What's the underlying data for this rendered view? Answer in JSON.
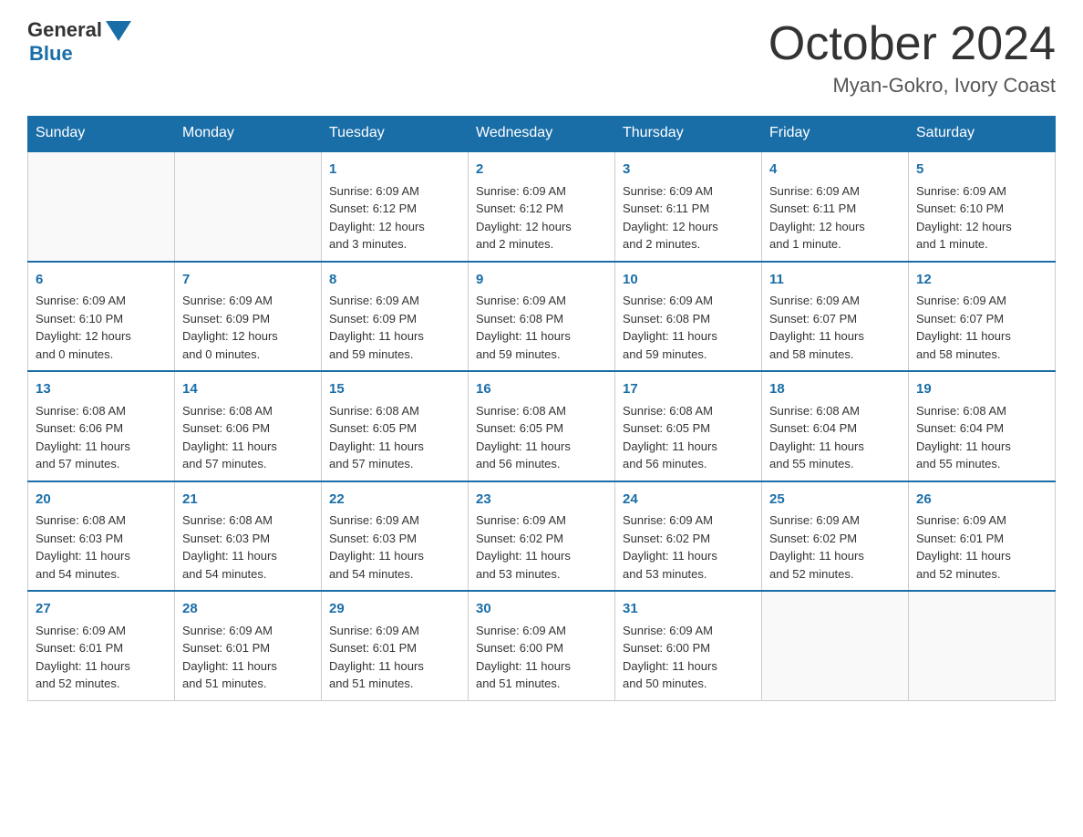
{
  "header": {
    "logo_general": "General",
    "logo_blue": "Blue",
    "month_title": "October 2024",
    "location": "Myan-Gokro, Ivory Coast"
  },
  "days_of_week": [
    "Sunday",
    "Monday",
    "Tuesday",
    "Wednesday",
    "Thursday",
    "Friday",
    "Saturday"
  ],
  "weeks": [
    [
      {
        "day": "",
        "content": ""
      },
      {
        "day": "",
        "content": ""
      },
      {
        "day": "1",
        "content": "Sunrise: 6:09 AM\nSunset: 6:12 PM\nDaylight: 12 hours\nand 3 minutes."
      },
      {
        "day": "2",
        "content": "Sunrise: 6:09 AM\nSunset: 6:12 PM\nDaylight: 12 hours\nand 2 minutes."
      },
      {
        "day": "3",
        "content": "Sunrise: 6:09 AM\nSunset: 6:11 PM\nDaylight: 12 hours\nand 2 minutes."
      },
      {
        "day": "4",
        "content": "Sunrise: 6:09 AM\nSunset: 6:11 PM\nDaylight: 12 hours\nand 1 minute."
      },
      {
        "day": "5",
        "content": "Sunrise: 6:09 AM\nSunset: 6:10 PM\nDaylight: 12 hours\nand 1 minute."
      }
    ],
    [
      {
        "day": "6",
        "content": "Sunrise: 6:09 AM\nSunset: 6:10 PM\nDaylight: 12 hours\nand 0 minutes."
      },
      {
        "day": "7",
        "content": "Sunrise: 6:09 AM\nSunset: 6:09 PM\nDaylight: 12 hours\nand 0 minutes."
      },
      {
        "day": "8",
        "content": "Sunrise: 6:09 AM\nSunset: 6:09 PM\nDaylight: 11 hours\nand 59 minutes."
      },
      {
        "day": "9",
        "content": "Sunrise: 6:09 AM\nSunset: 6:08 PM\nDaylight: 11 hours\nand 59 minutes."
      },
      {
        "day": "10",
        "content": "Sunrise: 6:09 AM\nSunset: 6:08 PM\nDaylight: 11 hours\nand 59 minutes."
      },
      {
        "day": "11",
        "content": "Sunrise: 6:09 AM\nSunset: 6:07 PM\nDaylight: 11 hours\nand 58 minutes."
      },
      {
        "day": "12",
        "content": "Sunrise: 6:09 AM\nSunset: 6:07 PM\nDaylight: 11 hours\nand 58 minutes."
      }
    ],
    [
      {
        "day": "13",
        "content": "Sunrise: 6:08 AM\nSunset: 6:06 PM\nDaylight: 11 hours\nand 57 minutes."
      },
      {
        "day": "14",
        "content": "Sunrise: 6:08 AM\nSunset: 6:06 PM\nDaylight: 11 hours\nand 57 minutes."
      },
      {
        "day": "15",
        "content": "Sunrise: 6:08 AM\nSunset: 6:05 PM\nDaylight: 11 hours\nand 57 minutes."
      },
      {
        "day": "16",
        "content": "Sunrise: 6:08 AM\nSunset: 6:05 PM\nDaylight: 11 hours\nand 56 minutes."
      },
      {
        "day": "17",
        "content": "Sunrise: 6:08 AM\nSunset: 6:05 PM\nDaylight: 11 hours\nand 56 minutes."
      },
      {
        "day": "18",
        "content": "Sunrise: 6:08 AM\nSunset: 6:04 PM\nDaylight: 11 hours\nand 55 minutes."
      },
      {
        "day": "19",
        "content": "Sunrise: 6:08 AM\nSunset: 6:04 PM\nDaylight: 11 hours\nand 55 minutes."
      }
    ],
    [
      {
        "day": "20",
        "content": "Sunrise: 6:08 AM\nSunset: 6:03 PM\nDaylight: 11 hours\nand 54 minutes."
      },
      {
        "day": "21",
        "content": "Sunrise: 6:08 AM\nSunset: 6:03 PM\nDaylight: 11 hours\nand 54 minutes."
      },
      {
        "day": "22",
        "content": "Sunrise: 6:09 AM\nSunset: 6:03 PM\nDaylight: 11 hours\nand 54 minutes."
      },
      {
        "day": "23",
        "content": "Sunrise: 6:09 AM\nSunset: 6:02 PM\nDaylight: 11 hours\nand 53 minutes."
      },
      {
        "day": "24",
        "content": "Sunrise: 6:09 AM\nSunset: 6:02 PM\nDaylight: 11 hours\nand 53 minutes."
      },
      {
        "day": "25",
        "content": "Sunrise: 6:09 AM\nSunset: 6:02 PM\nDaylight: 11 hours\nand 52 minutes."
      },
      {
        "day": "26",
        "content": "Sunrise: 6:09 AM\nSunset: 6:01 PM\nDaylight: 11 hours\nand 52 minutes."
      }
    ],
    [
      {
        "day": "27",
        "content": "Sunrise: 6:09 AM\nSunset: 6:01 PM\nDaylight: 11 hours\nand 52 minutes."
      },
      {
        "day": "28",
        "content": "Sunrise: 6:09 AM\nSunset: 6:01 PM\nDaylight: 11 hours\nand 51 minutes."
      },
      {
        "day": "29",
        "content": "Sunrise: 6:09 AM\nSunset: 6:01 PM\nDaylight: 11 hours\nand 51 minutes."
      },
      {
        "day": "30",
        "content": "Sunrise: 6:09 AM\nSunset: 6:00 PM\nDaylight: 11 hours\nand 51 minutes."
      },
      {
        "day": "31",
        "content": "Sunrise: 6:09 AM\nSunset: 6:00 PM\nDaylight: 11 hours\nand 50 minutes."
      },
      {
        "day": "",
        "content": ""
      },
      {
        "day": "",
        "content": ""
      }
    ]
  ]
}
